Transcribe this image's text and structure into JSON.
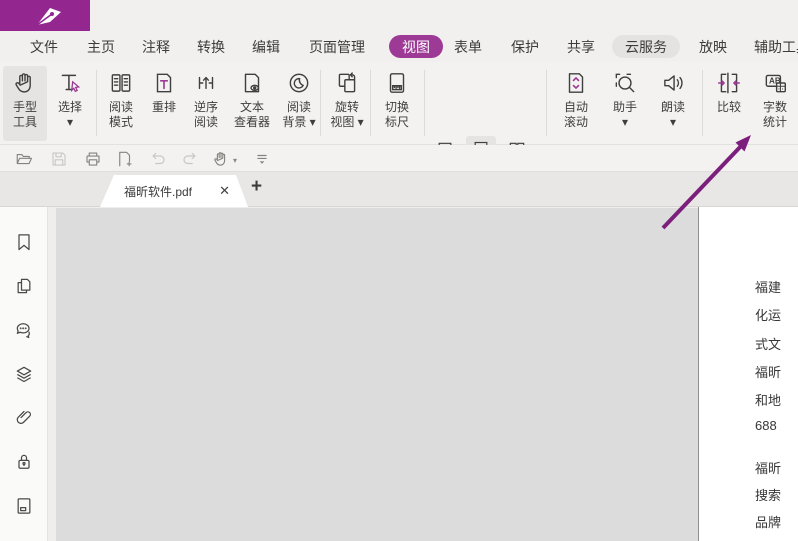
{
  "app": {
    "accent_color": "#93278f",
    "menu_active_color": "#9c3a96",
    "arrow_color": "#7c1f7c",
    "logo_icon": "pen-nib-icon"
  },
  "menubar": {
    "items": [
      {
        "label": "文件",
        "state": "normal"
      },
      {
        "label": "主页",
        "state": "normal"
      },
      {
        "label": "注释",
        "state": "normal"
      },
      {
        "label": "转换",
        "state": "normal"
      },
      {
        "label": "编辑",
        "state": "normal"
      },
      {
        "label": "页面管理",
        "state": "normal"
      },
      {
        "label": "视图",
        "state": "active"
      },
      {
        "label": "表单",
        "state": "normal"
      },
      {
        "label": "保护",
        "state": "normal"
      },
      {
        "label": "共享",
        "state": "normal"
      },
      {
        "label": "云服务",
        "state": "hover"
      },
      {
        "label": "放映",
        "state": "normal"
      },
      {
        "label": "辅助工具",
        "state": "normal"
      }
    ]
  },
  "ribbon": {
    "items": [
      {
        "label": "手型\n工具",
        "icon": "hand-tool-icon",
        "selected": true
      },
      {
        "label": "选择\n▾",
        "icon": "select-text-icon"
      },
      {
        "label": "阅读\n模式",
        "icon": "read-mode-icon"
      },
      {
        "label": "重排",
        "icon": "reflow-icon"
      },
      {
        "label": "逆序\n阅读",
        "icon": "reverse-reading-icon"
      },
      {
        "label": "文本\n查看器",
        "icon": "text-viewer-icon"
      },
      {
        "label": "阅读\n背景 ▾",
        "icon": "reading-background-icon"
      },
      {
        "label": "旋转\n视图 ▾",
        "icon": "rotate-view-icon"
      },
      {
        "label": "切换\n标尺",
        "icon": "toggle-ruler-icon"
      },
      {
        "label": "自动\n滚动",
        "icon": "auto-scroll-icon"
      },
      {
        "label": "助手\n▾",
        "icon": "assistant-icon"
      },
      {
        "label": "朗读\n▾",
        "icon": "read-aloud-icon"
      },
      {
        "label": "比较",
        "icon": "compare-icon"
      },
      {
        "label": "字数\n统计",
        "icon": "word-count-icon"
      }
    ],
    "page_layout_icons": [
      "single-page",
      "continuous",
      "facing",
      "continuous-facing",
      "separate-cover",
      "split"
    ],
    "page_layout_selected": "continuous"
  },
  "quickbar": {
    "icons": [
      "open-folder",
      "save",
      "print",
      "new-document",
      "undo",
      "redo",
      "hand-tool",
      "collapse-toolbar"
    ]
  },
  "tabbar": {
    "tab_title": "福昕软件.pdf",
    "close_label": "✕",
    "new_tab_label": "+"
  },
  "sidebar": {
    "icons": [
      "bookmarks",
      "pages",
      "comments",
      "layers",
      "attachments",
      "security",
      "form-fields"
    ]
  },
  "document": {
    "page2_lines": [
      "福建",
      "化运",
      "式文",
      "福昕",
      "和地",
      "688",
      "福昕",
      "搜索",
      "品牌"
    ]
  }
}
